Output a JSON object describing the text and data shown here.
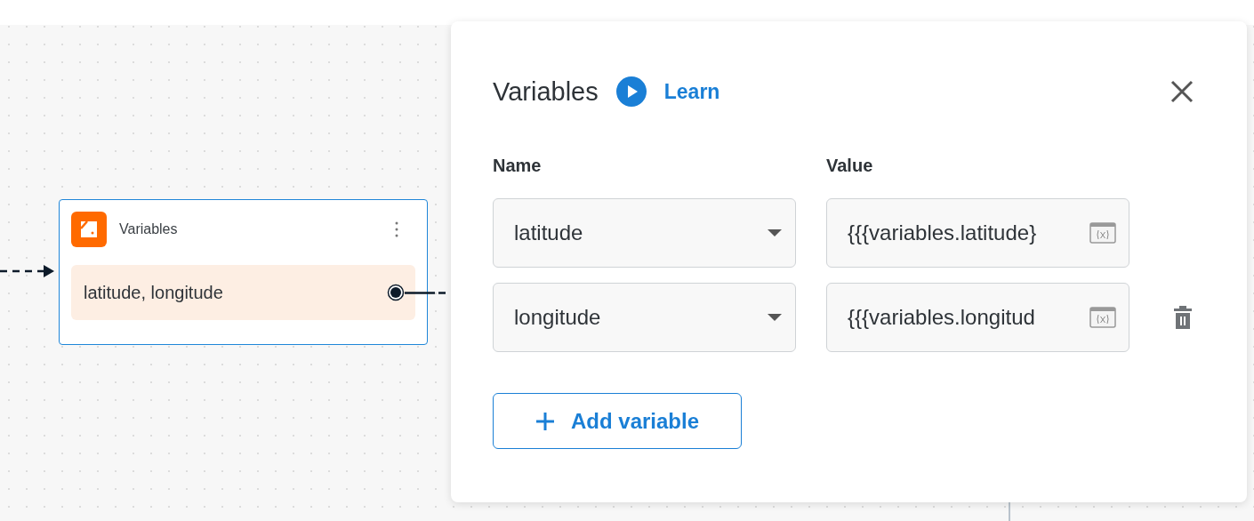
{
  "node": {
    "title": "Variables",
    "output": "latitude, longitude"
  },
  "panel": {
    "title": "Variables",
    "learn_link": "Learn",
    "columns": [
      "Name",
      "Value"
    ],
    "rows": [
      {
        "name": "latitude",
        "value": "{{{variables.latitude}",
        "deletable": false
      },
      {
        "name": "longitude",
        "value": "{{{variables.longitud",
        "deletable": true
      }
    ],
    "add_button": "Add variable"
  }
}
